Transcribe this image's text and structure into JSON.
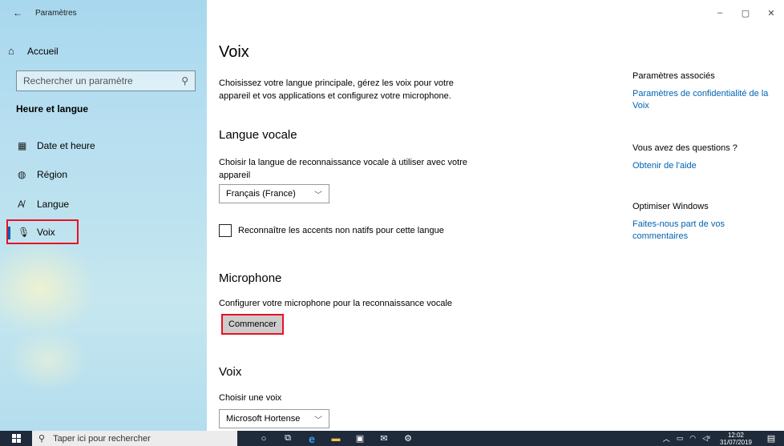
{
  "window": {
    "app_title": "Paramètres",
    "controls": {
      "minimize": "–",
      "restore": "▢",
      "close": "✕"
    }
  },
  "sidebar": {
    "home_label": "Accueil",
    "search_placeholder": "Rechercher un paramètre",
    "section_title": "Heure et langue",
    "items": [
      {
        "label": "Date et heure",
        "icon": "calendar-clock-icon"
      },
      {
        "label": "Région",
        "icon": "globe-icon"
      },
      {
        "label": "Langue",
        "icon": "language-icon"
      },
      {
        "label": "Voix",
        "icon": "microphone-icon",
        "selected": true
      }
    ]
  },
  "main": {
    "title": "Voix",
    "intro": "Choisissez votre langue principale, gérez les voix pour votre appareil et vos applications et configurez votre microphone.",
    "langue": {
      "heading": "Langue vocale",
      "description": "Choisir la langue de reconnaissance vocale à utiliser avec votre appareil",
      "selected": "Français (France)",
      "checkbox_label": "Reconnaître les accents non natifs pour cette langue",
      "checkbox_checked": false
    },
    "microphone": {
      "heading": "Microphone",
      "description": "Configurer votre microphone pour la reconnaissance vocale",
      "button": "Commencer"
    },
    "voix": {
      "heading": "Voix",
      "description": "Choisir une voix",
      "selected": "Microsoft Hortense"
    }
  },
  "related": {
    "heading1": "Paramètres associés",
    "link1": "Paramètres de confidentialité de la Voix",
    "heading2": "Vous avez des questions ?",
    "link2": "Obtenir de l'aide",
    "heading3": "Optimiser Windows",
    "link3": "Faites-nous part de vos commentaires"
  },
  "taskbar": {
    "search_placeholder": "Taper ici pour rechercher",
    "time": "12:02",
    "date": "31/07/2019"
  },
  "colors": {
    "accent": "#0063b1",
    "highlight": "#e81123",
    "taskbar": "#1f2a3a"
  }
}
